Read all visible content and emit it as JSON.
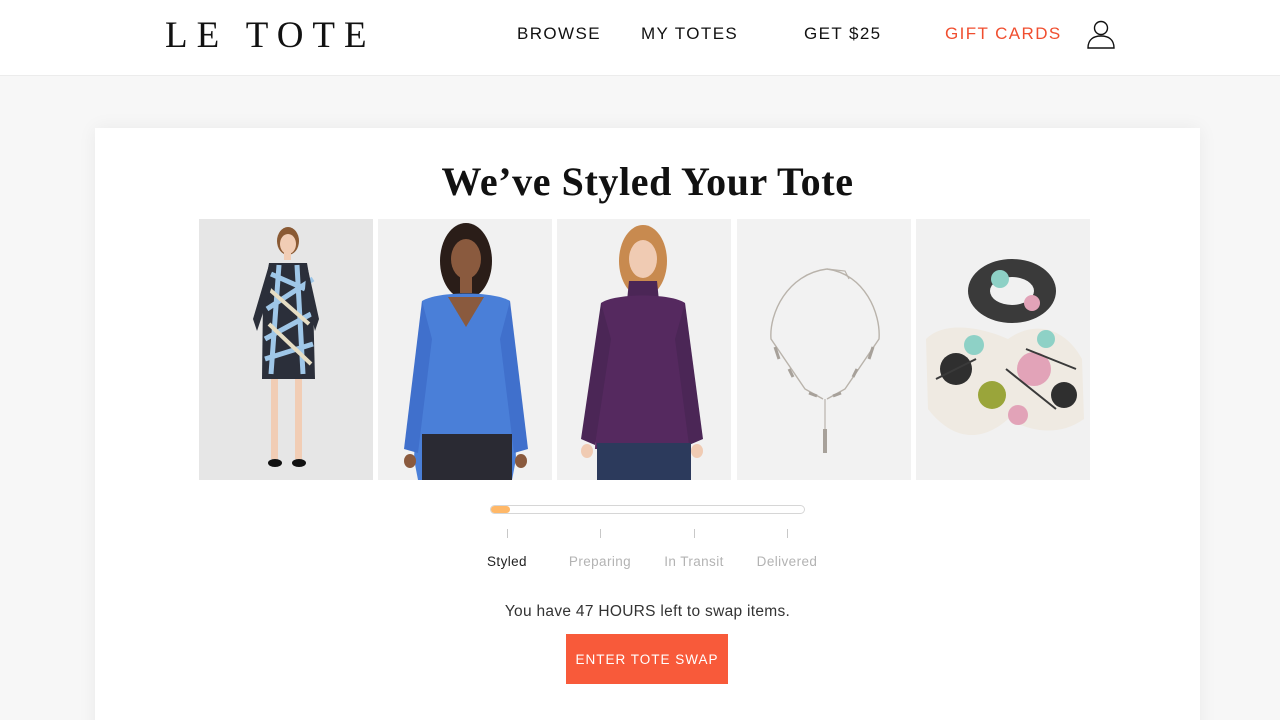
{
  "header": {
    "logo": "LE TOTE",
    "nav": {
      "browse": "BROWSE",
      "my_totes": "MY TOTES",
      "get_25": "GET $25",
      "gift_cards": "GIFT CARDS"
    },
    "account_icon": "user-icon"
  },
  "colors": {
    "accent": "#f04e2f",
    "button": "#f85a3a",
    "progress": "#ffb868"
  },
  "tote": {
    "title": "We’ve Styled Your Tote",
    "items": [
      {
        "name": "plaid-shift-dress"
      },
      {
        "name": "blue-v-neck-sweater"
      },
      {
        "name": "purple-mock-neck-top"
      },
      {
        "name": "silver-bar-necklace"
      },
      {
        "name": "floral-print-scarf"
      }
    ],
    "progress": {
      "fraction": 0.06,
      "steps": [
        "Styled",
        "Preparing",
        "In Transit",
        "Delivered"
      ],
      "active_step": 0
    },
    "swap_message": "You have 47 HOURS left to swap items.",
    "cta_label": "ENTER TOTE SWAP"
  }
}
